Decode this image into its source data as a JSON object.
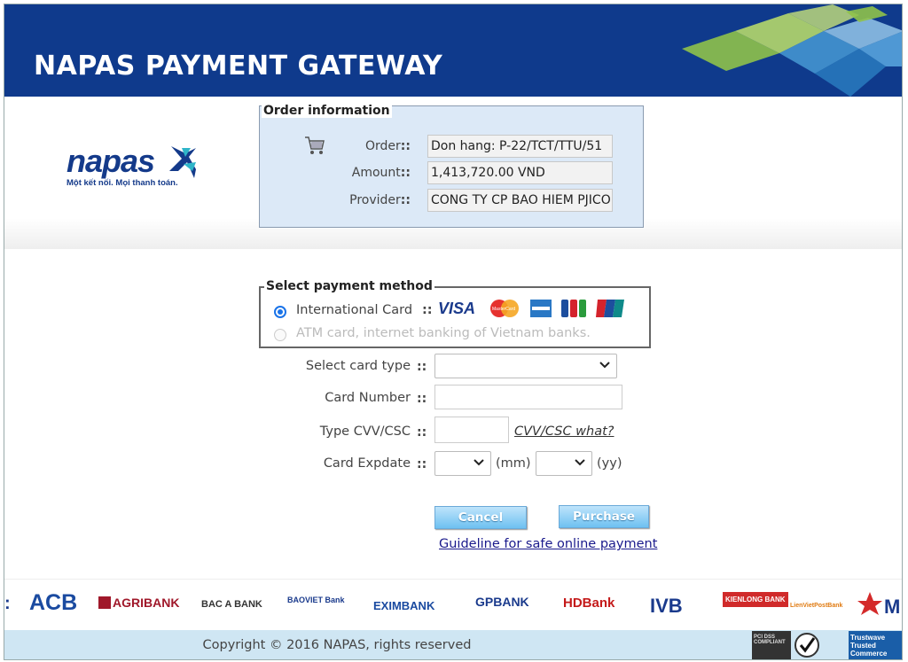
{
  "banner": {
    "title": "NAPAS PAYMENT GATEWAY"
  },
  "logo": {
    "word": "napas",
    "tagline": "Một kết nối. Mọi thanh toán."
  },
  "order": {
    "legend": "Order information",
    "separator": "::",
    "fields": [
      {
        "label": "Order",
        "value": "Don hang: P-22/TCT/TTU/51"
      },
      {
        "label": "Amount",
        "value": "1,413,720.00 VND"
      },
      {
        "label": "Provider",
        "value": "CONG TY CP BAO HIEM PJICO"
      }
    ]
  },
  "payment_method": {
    "legend": "Select payment method",
    "separator": "::",
    "options": [
      {
        "label": "International Card",
        "selected": true
      },
      {
        "label": "ATM card, internet banking of Vietnam banks.",
        "selected": false
      }
    ],
    "card_brands": [
      "VISA",
      "MasterCard",
      "American Express",
      "JCB",
      "UnionPay"
    ]
  },
  "form": {
    "separator": "::",
    "card_type_label": "Select card type",
    "card_number_label": "Card Number",
    "cvv_label": "Type CVV/CSC",
    "cvv_help": "CVV/CSC what?",
    "expdate_label": "Card Expdate",
    "month_unit": "(mm)",
    "year_unit": "(yy)"
  },
  "buttons": {
    "cancel": "Cancel",
    "purchase": "Purchase"
  },
  "guideline_link": "Guideline for safe online payment",
  "banks": [
    "ACB",
    "AGRIBANK",
    "BAC A BANK",
    "BAOVIET Bank",
    "EXIMBANK",
    "GPBANK",
    "HDBank",
    "IVB",
    "KIENLONG BANK",
    "LienVietPostBank"
  ],
  "footer": {
    "copyright": "Copyright © 2016 NAPAS, rights reserved",
    "seals": [
      "PCI DSS COMPLIANT",
      "VeriSign Secured",
      "Trustwave Trusted Commerce"
    ]
  },
  "colors": {
    "banner": "#0f3a8c",
    "order_bg": "#dce9f7",
    "footer_bg": "#cfe6f3",
    "button": "#6ec1f1",
    "radio": "#1a73e8"
  }
}
